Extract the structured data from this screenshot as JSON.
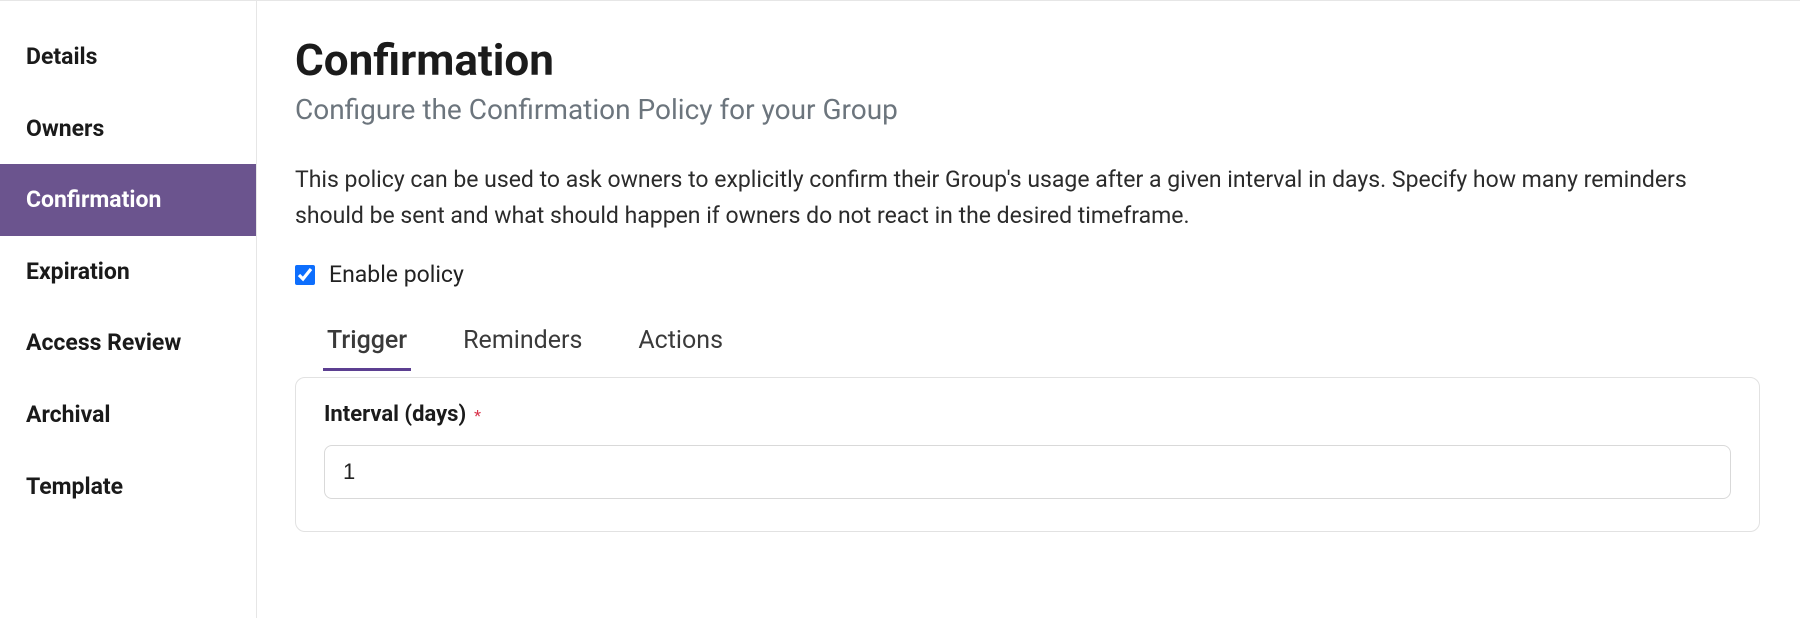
{
  "sidebar": {
    "items": [
      {
        "label": "Details",
        "active": false
      },
      {
        "label": "Owners",
        "active": false
      },
      {
        "label": "Confirmation",
        "active": true
      },
      {
        "label": "Expiration",
        "active": false
      },
      {
        "label": "Access Review",
        "active": false
      },
      {
        "label": "Archival",
        "active": false
      },
      {
        "label": "Template",
        "active": false
      }
    ]
  },
  "main": {
    "title": "Confirmation",
    "subtitle": "Configure the Confirmation Policy for your Group",
    "description": "This policy can be used to ask owners to explicitly confirm their Group's usage after a given interval in days. Specify how many reminders should be sent and what should happen if owners do not react in the desired timeframe.",
    "enable_label": "Enable policy",
    "enable_checked": true,
    "tabs": [
      {
        "label": "Trigger",
        "active": true
      },
      {
        "label": "Reminders",
        "active": false
      },
      {
        "label": "Actions",
        "active": false
      }
    ],
    "trigger": {
      "interval_label": "Interval (days)",
      "interval_required_mark": "*",
      "interval_value": "1"
    }
  }
}
